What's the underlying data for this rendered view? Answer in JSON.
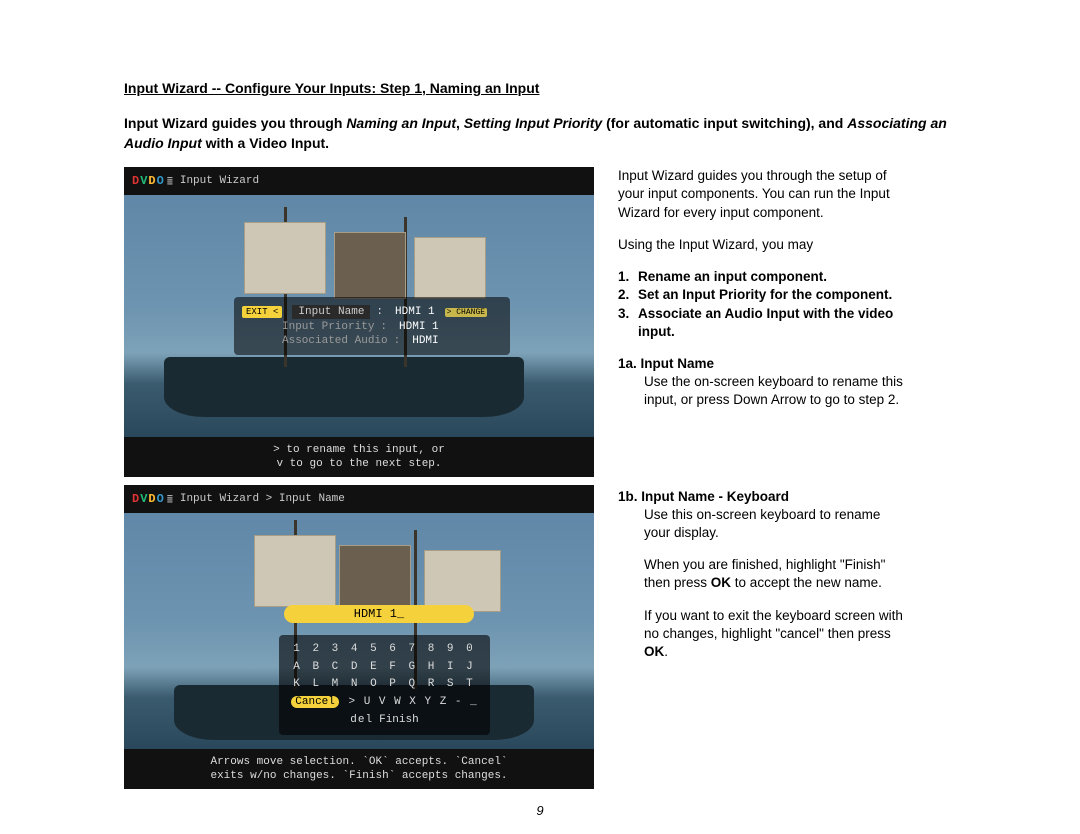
{
  "title": "Input Wizard -- Configure Your Inputs:  Step 1,  Naming an Input",
  "intro_parts": {
    "a": "Input Wizard guides you through ",
    "b_em": "Naming an Input",
    "c": ", ",
    "d_em": "Setting Input Priority",
    "e": " (for automatic input switching), and ",
    "f_em": "Associating an Audio Input",
    "g": " with a Video Input."
  },
  "right": {
    "p1": "Input Wizard guides you through the setup of your input components.  You can run the Input Wizard for every input component.",
    "p2": "Using the Input Wizard, you may",
    "list": [
      {
        "n": "1.",
        "t": "Rename an input component."
      },
      {
        "n": "2.",
        "t": "Set an Input Priority for the component."
      },
      {
        "n": "3.",
        "t": "Associate an Audio Input with the video input."
      }
    ],
    "s1a_head": "1a.  Input Name",
    "s1a_body": "Use the on-screen keyboard to rename this input, or press Down Arrow to go to step 2.",
    "s1b_head": "1b.  Input Name - Keyboard",
    "s1b_p1": "Use this on-screen keyboard to rename your display.",
    "s1b_p2a": "When you are finished, highlight \"Finish\"  then press ",
    "s1b_p2b": "OK",
    "s1b_p2c": " to accept the new name.",
    "s1b_p3a": "If you want to exit the keyboard screen with no changes, highlight \"cancel\" then press ",
    "s1b_p3b": "OK",
    "s1b_p3c": "."
  },
  "shot1": {
    "breadcrumb": "Input Wizard",
    "menu": {
      "exit": "EXIT <",
      "label": "Input Name",
      "sep": ":",
      "value": "HDMI 1",
      "change": "> CHANGE",
      "row2_l": "Input Priority",
      "row2_v": "HDMI 1",
      "row3_l": "Associated Audio",
      "row3_v": "HDMI"
    },
    "footer1": "> to rename this input, or",
    "footer2": "v to go to the next step."
  },
  "shot2": {
    "breadcrumb": "Input Wizard > Input Name",
    "name": "HDMI 1_",
    "kbd_r1": "1 2 3 4 5 6 7 8 9 0",
    "kbd_r2": "A B C D E F G H I J",
    "kbd_r3": "K L M N O P Q R S T",
    "kbd_cancel": "Cancel",
    "kbd_r4_mid": " > U V W X Y Z - _ del",
    "kbd_finish": "Finish",
    "footer1": "Arrows move selection. `OK` accepts. `Cancel`",
    "footer2": "exits w/no changes. `Finish` accepts changes."
  },
  "page_number": "9"
}
